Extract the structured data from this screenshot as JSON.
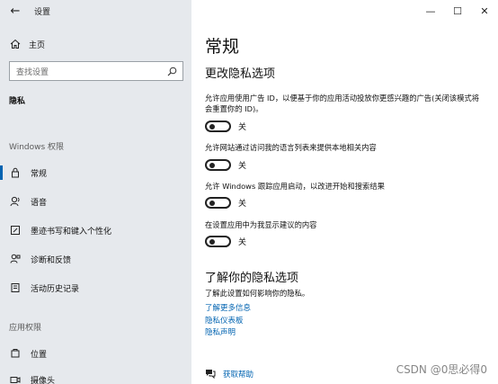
{
  "window": {
    "title": "设置",
    "minimize_glyph": "—",
    "maximize_glyph": "☐",
    "close_glyph": "✕"
  },
  "sidebar": {
    "home_label": "主页",
    "search_placeholder": "查找设置",
    "current_section": "隐私",
    "groups": [
      {
        "label": "Windows 权限",
        "items": [
          {
            "label": "常规",
            "icon": "lock-icon",
            "active": true
          },
          {
            "label": "语音",
            "icon": "speech-icon",
            "active": false
          },
          {
            "label": "墨迹书写和键入个性化",
            "icon": "pen-icon",
            "active": false
          },
          {
            "label": "诊断和反馈",
            "icon": "feedback-icon",
            "active": false
          },
          {
            "label": "活动历史记录",
            "icon": "history-icon",
            "active": false
          }
        ]
      },
      {
        "label": "应用权限",
        "items": [
          {
            "label": "位置",
            "icon": "location-icon",
            "active": false
          },
          {
            "label": "摄像头",
            "icon": "camera-icon",
            "active": false
          }
        ]
      }
    ]
  },
  "main": {
    "title": "常规",
    "privacy_options_heading": "更改隐私选项",
    "options": [
      {
        "description": "允许应用使用广告 ID，以便基于你的应用活动投放你更感兴趣的广告(关闭该模式将会重置你的 ID)。",
        "state_label": "关",
        "on": false
      },
      {
        "description": "允许网站通过访问我的语言列表来提供本地相关内容",
        "state_label": "关",
        "on": false
      },
      {
        "description": "允许 Windows 跟踪应用启动，以改进开始和搜索结果",
        "state_label": "关",
        "on": false
      },
      {
        "description": "在设置应用中为我显示建议的内容",
        "state_label": "关",
        "on": false
      }
    ],
    "learn_heading": "了解你的隐私选项",
    "learn_desc": "了解此设置如何影响你的隐私。",
    "links": [
      "了解更多信息",
      "隐私仪表板",
      "隐私声明"
    ],
    "help_label": "获取帮助"
  },
  "watermark": "CSDN @0思必得0",
  "colors": {
    "accent": "#0063b1",
    "sidebar_bg": "#e6e9ed"
  }
}
